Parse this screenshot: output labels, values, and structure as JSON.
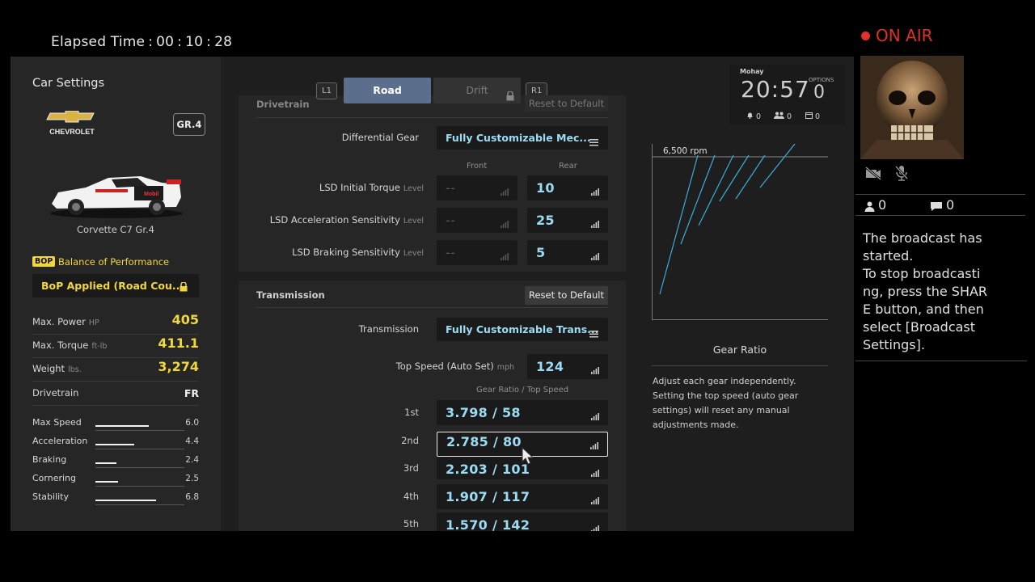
{
  "header": {
    "elapsed_label": "Elapsed Time",
    "elapsed_h": "00",
    "elapsed_m": "10",
    "elapsed_s": "28"
  },
  "sidebar": {
    "title": "Car Settings",
    "brand": "CHEVROLET",
    "class_badge": "GR.4",
    "car_name": "Corvette C7 Gr.4",
    "bop_tag": "BOP",
    "bop_label": "Balance of Performance",
    "bop_value": "BoP Applied (Road Cou...",
    "specs": [
      {
        "label": "Max. Power",
        "unit": "HP",
        "value": "405"
      },
      {
        "label": "Max. Torque",
        "unit": "ft-lb",
        "value": "411.1"
      },
      {
        "label": "Weight",
        "unit": "lbs.",
        "value": "3,274"
      },
      {
        "label": "Drivetrain",
        "unit": "",
        "value": "FR"
      }
    ],
    "performance": [
      {
        "label": "Max Speed",
        "value": "6.0",
        "level": 0.6
      },
      {
        "label": "Acceleration",
        "value": "4.4",
        "level": 0.44
      },
      {
        "label": "Braking",
        "value": "2.4",
        "level": 0.24
      },
      {
        "label": "Cornering",
        "value": "2.5",
        "level": 0.25
      },
      {
        "label": "Stability",
        "value": "6.8",
        "level": 0.68
      }
    ]
  },
  "tabs": {
    "left_key": "L1",
    "right_key": "R1",
    "road": "Road",
    "drift": "Drift"
  },
  "drivetrain": {
    "title": "Drivetrain",
    "reset": "Reset to Default",
    "diff_label": "Differential Gear",
    "diff_value": "Fully Customizable Mec...",
    "col_front": "Front",
    "col_rear": "Rear",
    "rows": [
      {
        "label": "LSD Initial Torque",
        "unit": "Level",
        "front": "--",
        "rear": "10"
      },
      {
        "label": "LSD Acceleration Sensitivity",
        "unit": "Level",
        "front": "--",
        "rear": "25"
      },
      {
        "label": "LSD Braking Sensitivity",
        "unit": "Level",
        "front": "--",
        "rear": "5"
      }
    ]
  },
  "transmission": {
    "title": "Transmission",
    "reset": "Reset to Default",
    "trans_label": "Transmission",
    "trans_value": "Fully Customizable Trans...",
    "top_speed_label": "Top Speed (Auto Set)",
    "top_speed_unit": "mph",
    "top_speed_value": "124",
    "gear_header": "Gear Ratio / Top Speed",
    "gears": [
      {
        "label": "1st",
        "value": "3.798 / 58"
      },
      {
        "label": "2nd",
        "value": "2.785 / 80"
      },
      {
        "label": "3rd",
        "value": "2.203 / 101"
      },
      {
        "label": "4th",
        "value": "1.907 / 117"
      },
      {
        "label": "5th",
        "value": "1.570 / 142"
      }
    ]
  },
  "graph": {
    "rpm_label": "6,500 rpm",
    "title": "Gear Ratio",
    "description": "Adjust each gear independently. Setting the top speed (auto gear settings) will reset any manual adjustments made.",
    "line_color": "#3aaed8"
  },
  "time_widget": {
    "user": "Mohay",
    "time": "20:57",
    "options": "OPTIONS",
    "count": "0",
    "notif": "0",
    "friends": "0",
    "events": "0"
  },
  "broadcast": {
    "on_air": "ON AIR",
    "viewers": "0",
    "comments": "0",
    "message_lines": [
      "The broadcast has",
      "started.",
      "To stop broadcasti",
      "ng, press the SHAR",
      "E button, and then",
      "select [Broadcast",
      "Settings]."
    ]
  }
}
